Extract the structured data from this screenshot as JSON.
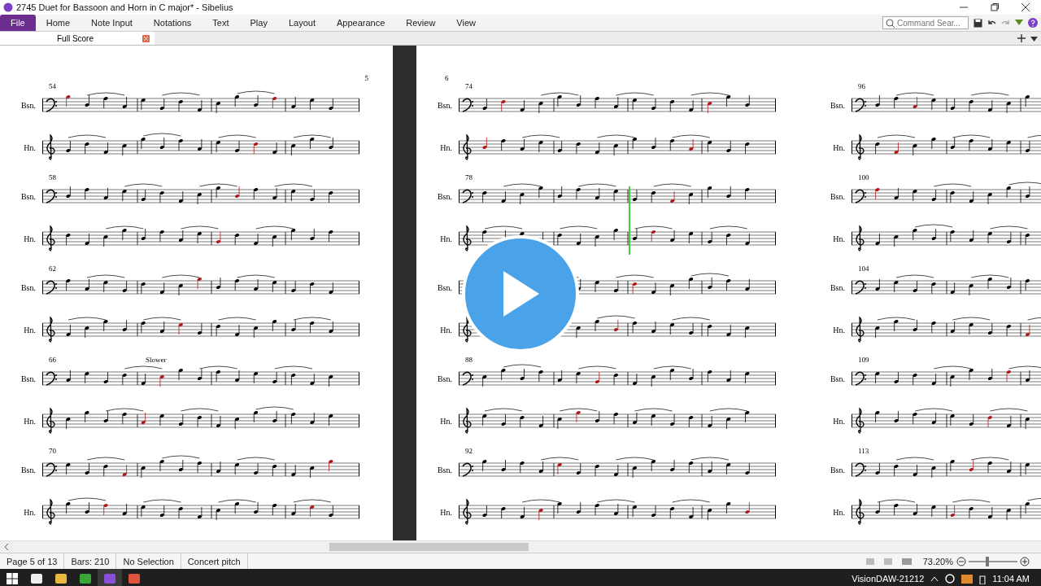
{
  "window": {
    "title": "2745 Duet for Bassoon and Horn in C major* - Sibelius"
  },
  "ribbon": {
    "tabs": [
      {
        "label": "File",
        "selected": true
      },
      {
        "label": "Home",
        "selected": false
      },
      {
        "label": "Note Input",
        "selected": false
      },
      {
        "label": "Notations",
        "selected": false
      },
      {
        "label": "Text",
        "selected": false
      },
      {
        "label": "Play",
        "selected": false
      },
      {
        "label": "Layout",
        "selected": false
      },
      {
        "label": "Appearance",
        "selected": false
      },
      {
        "label": "Review",
        "selected": false
      },
      {
        "label": "View",
        "selected": false
      }
    ],
    "search": {
      "placeholder": "Command Sear..."
    }
  },
  "document_tab": {
    "label": "Full Score"
  },
  "pages": [
    {
      "kind": "recto",
      "page_number": "5",
      "systems": [
        {
          "bar": "54",
          "staves": [
            {
              "label": "Bsn.",
              "kind": "bass"
            },
            {
              "label": "Hn.",
              "kind": "treble"
            }
          ]
        },
        {
          "bar": "58",
          "staves": [
            {
              "label": "Bsn.",
              "kind": "bass"
            },
            {
              "label": "Hn.",
              "kind": "treble"
            }
          ]
        },
        {
          "bar": "62",
          "staves": [
            {
              "label": "Bsn.",
              "kind": "bass"
            },
            {
              "label": "Hn.",
              "kind": "treble"
            }
          ]
        },
        {
          "bar": "66",
          "tempo": "Slower",
          "staves": [
            {
              "label": "Bsn.",
              "kind": "bass"
            },
            {
              "label": "Hn.",
              "kind": "treble"
            }
          ]
        },
        {
          "bar": "70",
          "staves": [
            {
              "label": "Bsn.",
              "kind": "bass"
            },
            {
              "label": "Hn.",
              "kind": "treble"
            }
          ]
        }
      ]
    },
    {
      "kind": "verso",
      "page_number": "6",
      "systems": [
        {
          "bar": "74",
          "staves": [
            {
              "label": "Bsn.",
              "kind": "bass"
            },
            {
              "label": "Hn.",
              "kind": "treble"
            }
          ]
        },
        {
          "bar": "78",
          "playhead": true,
          "staves": [
            {
              "label": "Bsn.",
              "kind": "bass"
            },
            {
              "label": "Hn.",
              "kind": "treble"
            }
          ]
        },
        {
          "staves": [
            {
              "label": "Bsn.",
              "kind": "bass"
            },
            {
              "label": "Hn.",
              "kind": "treble"
            }
          ]
        },
        {
          "bar": "88",
          "staves": [
            {
              "label": "Bsn.",
              "kind": "bass"
            },
            {
              "label": "Hn.",
              "kind": "treble"
            }
          ]
        },
        {
          "bar": "92",
          "staves": [
            {
              "label": "Bsn.",
              "kind": "bass"
            },
            {
              "label": "Hn.",
              "kind": "treble"
            }
          ]
        }
      ]
    },
    {
      "kind": "recto",
      "systems": [
        {
          "bar": "96",
          "staves": [
            {
              "label": "Bsn.",
              "kind": "bass"
            },
            {
              "label": "Hn.",
              "kind": "treble"
            }
          ]
        },
        {
          "bar": "100",
          "staves": [
            {
              "label": "Bsn.",
              "kind": "bass"
            },
            {
              "label": "Hn.",
              "kind": "treble"
            }
          ]
        },
        {
          "bar": "104",
          "staves": [
            {
              "label": "Bsn.",
              "kind": "bass"
            },
            {
              "label": "Hn.",
              "kind": "treble"
            }
          ]
        },
        {
          "bar": "109",
          "staves": [
            {
              "label": "Bsn.",
              "kind": "bass"
            },
            {
              "label": "Hn.",
              "kind": "treble"
            }
          ]
        },
        {
          "bar": "113",
          "staves": [
            {
              "label": "Bsn.",
              "kind": "bass"
            },
            {
              "label": "Hn.",
              "kind": "treble"
            }
          ]
        }
      ]
    }
  ],
  "status_bar": {
    "cells": [
      "Page 5 of 13",
      "Bars: 210",
      "No Selection",
      "Concert pitch"
    ],
    "zoom": "73.20%",
    "level": 0.37
  },
  "taskbar": {
    "apps": [
      {
        "kind": "document",
        "selected": false
      },
      {
        "kind": "folder",
        "selected": false
      },
      {
        "kind": "editor",
        "selected": false
      },
      {
        "kind": "music",
        "selected": true
      },
      {
        "kind": "recorder",
        "selected": false
      }
    ],
    "computer_name": "VisionDAW-21212",
    "clock": "11:04 AM"
  }
}
